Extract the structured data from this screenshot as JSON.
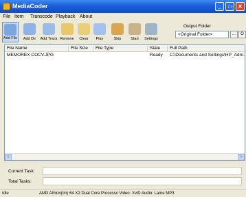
{
  "window": {
    "title": "MediaCoder"
  },
  "menu": [
    "File",
    "Item",
    "Transcode",
    "Playback",
    "About"
  ],
  "toolbar": [
    {
      "label": "Add File",
      "icon": "add-file-icon"
    },
    {
      "label": "Add Dir",
      "icon": "add-dir-icon"
    },
    {
      "label": "Add Track",
      "icon": "add-track-icon"
    },
    {
      "label": "Remove",
      "icon": "remove-icon"
    },
    {
      "label": "Clear",
      "icon": "clear-icon"
    },
    {
      "label": "Play",
      "icon": "play-icon"
    },
    {
      "label": "Skip",
      "icon": "skip-icon"
    },
    {
      "label": "Start",
      "icon": "start-icon"
    },
    {
      "label": "Settings",
      "icon": "settings-icon"
    }
  ],
  "output": {
    "label": "Output Folder",
    "value": "<Original Folder>",
    "browse": "...",
    "open": "O"
  },
  "file_list": {
    "columns": [
      "File Name",
      "File Size",
      "File Type",
      "State",
      "Full Path"
    ],
    "rows": [
      {
        "name": "MEMOREX COCV.JPG",
        "size": "",
        "type": "",
        "state": "Ready",
        "path": "C:\\Documents and Settings\\HP_Adm..."
      }
    ]
  },
  "tasks": {
    "current_label": "Current Task:",
    "total_label": "Total Tasks:"
  },
  "status": {
    "state": "Idle",
    "info": "AMD Athlon(tm) 64 X2 Dual Core Processc Video: XviD Audio: Lame MP3"
  },
  "colors": {
    "titlebar": "#1b5fd8",
    "close": "#d6482a",
    "active_button": "#c9d9f1"
  }
}
